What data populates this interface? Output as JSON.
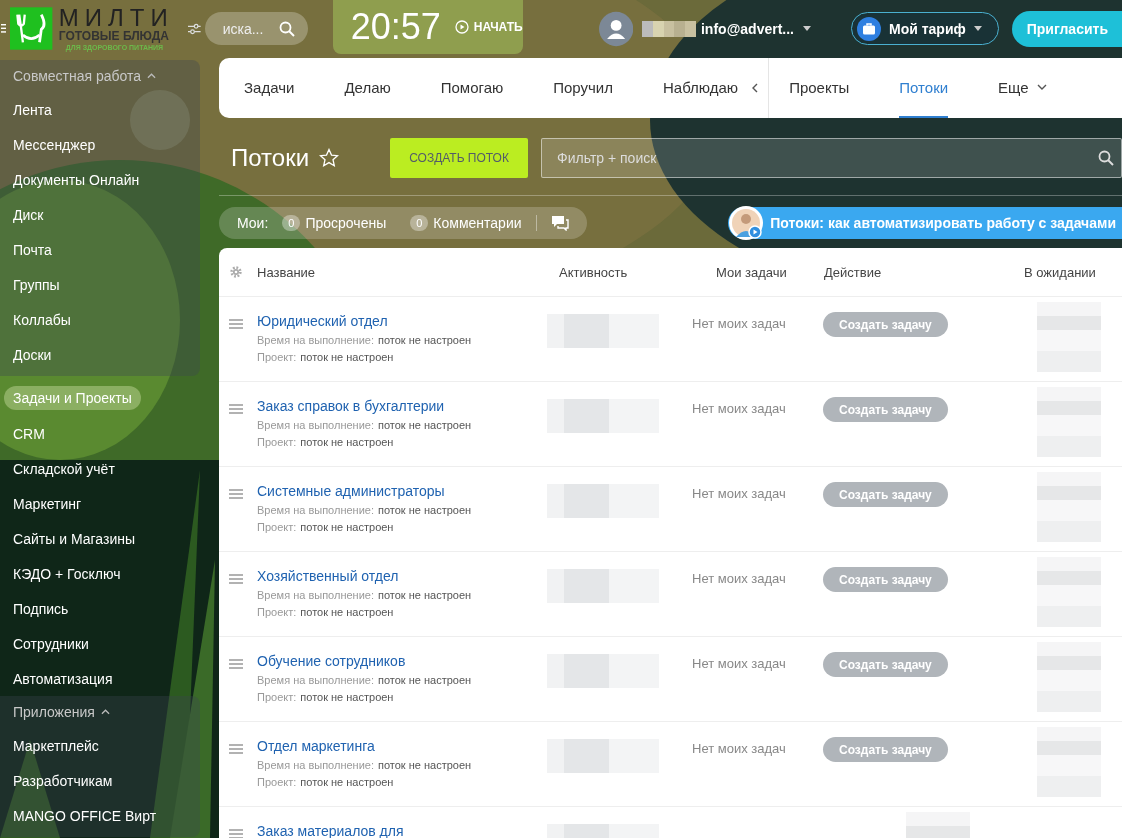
{
  "header": {
    "logo": {
      "title": "МИЛТИ",
      "subtitle": "ГОТОВЫЕ БЛЮДА",
      "tagline": "ДЛЯ ЗДОРОВОГО ПИТАНИЯ"
    },
    "search": {
      "placeholder": "иска..."
    },
    "clock": {
      "time": "20:57",
      "start_label": "НАЧАТЬ"
    },
    "user": {
      "email": "info@advert..."
    },
    "tariff_button": "Мой тариф",
    "invite_button": "Пригласить"
  },
  "sidebar": {
    "sections": [
      {
        "title": "Совместная работа",
        "expanded": true,
        "items": [
          {
            "label": "Лента",
            "selected": false
          },
          {
            "label": "Мессенджер",
            "selected": false
          },
          {
            "label": "Документы Онлайн",
            "selected": false
          },
          {
            "label": "Диск",
            "selected": false
          },
          {
            "label": "Почта",
            "selected": false
          },
          {
            "label": "Группы",
            "selected": false
          },
          {
            "label": "Коллабы",
            "selected": false
          },
          {
            "label": "Доски",
            "selected": false
          }
        ]
      },
      {
        "items": [
          {
            "label": "Задачи и Проекты",
            "selected": true
          },
          {
            "label": "CRM",
            "selected": false
          },
          {
            "label": "Складской учёт",
            "selected": false
          },
          {
            "label": "Маркетинг",
            "selected": false
          },
          {
            "label": "Сайты и Магазины",
            "selected": false
          },
          {
            "label": "КЭДО + Госключ",
            "selected": false
          },
          {
            "label": "Подпись",
            "selected": false
          },
          {
            "label": "Сотрудники",
            "selected": false
          },
          {
            "label": "Автоматизация",
            "selected": false
          }
        ]
      },
      {
        "title": "Приложения",
        "expanded": true,
        "items": [
          {
            "label": "Маркетплейс",
            "selected": false
          },
          {
            "label": "Разработчикам",
            "selected": false
          },
          {
            "label": "MANGO OFFICE Вирт",
            "selected": false
          }
        ]
      }
    ]
  },
  "tabs": {
    "left": [
      {
        "label": "Задачи",
        "selected": false
      },
      {
        "label": "Делаю",
        "selected": false
      },
      {
        "label": "Помогаю",
        "selected": false
      },
      {
        "label": "Поручил",
        "selected": false
      },
      {
        "label": "Наблюдаю",
        "selected": false
      }
    ],
    "right": [
      {
        "label": "Проекты",
        "selected": false
      },
      {
        "label": "Потоки",
        "selected": true
      },
      {
        "label": "Еще",
        "selected": false
      }
    ]
  },
  "page": {
    "title": "Потоки",
    "create_button": "СОЗДАТЬ ПОТОК",
    "filter": {
      "placeholder": "Фильтр + поиск"
    }
  },
  "counters": {
    "label": "Мои:",
    "items": [
      {
        "count": "0",
        "label": "Просрочены"
      },
      {
        "count": "0",
        "label": "Комментарии"
      }
    ]
  },
  "promo": {
    "text": "Потоки: как автоматизировать работу с задачами"
  },
  "table": {
    "columns": [
      "Название",
      "Активность",
      "Мои задачи",
      "Действие",
      "В ожидании"
    ],
    "rows": [
      {
        "name": "Юридический отдел",
        "time_label": "Время на выполнение:",
        "time_value": "поток не настроен",
        "project_label": "Проект:",
        "project_value": "поток не настроен",
        "my_tasks": "Нет моих задач",
        "action": "Создать задачу"
      },
      {
        "name": "Заказ справок в бухгалтерии",
        "time_label": "Время на выполнение:",
        "time_value": "поток не настроен",
        "project_label": "Проект:",
        "project_value": "поток не настроен",
        "my_tasks": "Нет моих задач",
        "action": "Создать задачу"
      },
      {
        "name": "Системные администраторы",
        "time_label": "Время на выполнение:",
        "time_value": "поток не настроен",
        "project_label": "Проект:",
        "project_value": "поток не настроен",
        "my_tasks": "Нет моих задач",
        "action": "Создать задачу"
      },
      {
        "name": "Хозяйственный отдел",
        "time_label": "Время на выполнение:",
        "time_value": "поток не настроен",
        "project_label": "Проект:",
        "project_value": "поток не настроен",
        "my_tasks": "Нет моих задач",
        "action": "Создать задачу"
      },
      {
        "name": "Обучение сотрудников",
        "time_label": "Время на выполнение:",
        "time_value": "поток не настроен",
        "project_label": "Проект:",
        "project_value": "поток не настроен",
        "my_tasks": "Нет моих задач",
        "action": "Создать задачу"
      },
      {
        "name": "Отдел маркетинга",
        "time_label": "Время на выполнение:",
        "time_value": "поток не настроен",
        "project_label": "Проект:",
        "project_value": "поток не настроен",
        "my_tasks": "Нет моих задач",
        "action": "Создать задачу"
      },
      {
        "name": "Заказ материалов для"
      }
    ]
  }
}
